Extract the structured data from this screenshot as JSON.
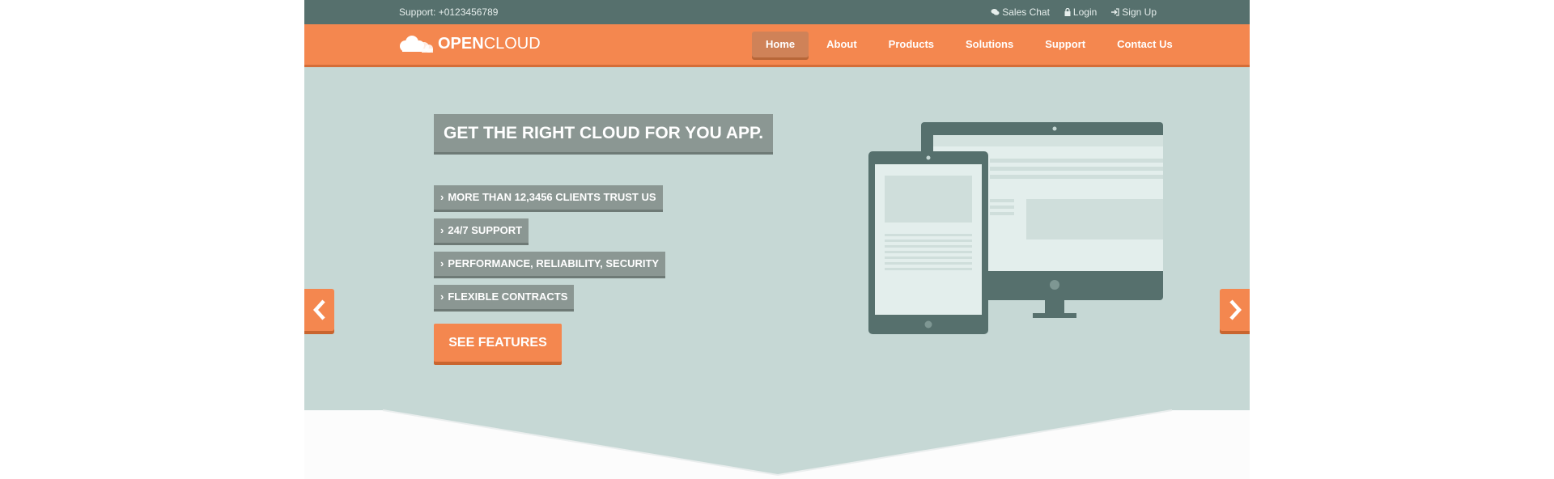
{
  "topbar": {
    "support": "Support: +0123456789",
    "links": [
      {
        "label": "Sales Chat",
        "icon": "chat-icon"
      },
      {
        "label": "Login",
        "icon": "lock-icon"
      },
      {
        "label": "Sign Up",
        "icon": "sign-in-icon"
      }
    ]
  },
  "brand": {
    "strong": "OPEN",
    "light": "CLOUD",
    "icon": "cloud-icon"
  },
  "nav": {
    "items": [
      "Home",
      "About",
      "Products",
      "Solutions",
      "Support",
      "Contact Us"
    ],
    "active": "Home"
  },
  "hero": {
    "headline": "GET THE RIGHT CLOUD FOR YOU APP.",
    "features": [
      "MORE THAN 12,3456 CLIENTS TRUST US",
      "24/7 SUPPORT",
      "PERFORMANCE, RELIABILITY, SECURITY",
      "FLEXIBLE CONTRACTS"
    ],
    "cta": "SEE FEATURES"
  },
  "colors": {
    "topbar": "#56706d",
    "accent": "#f4874f",
    "hero_bg": "#c6d8d5",
    "label_bg": "#8b9793"
  }
}
